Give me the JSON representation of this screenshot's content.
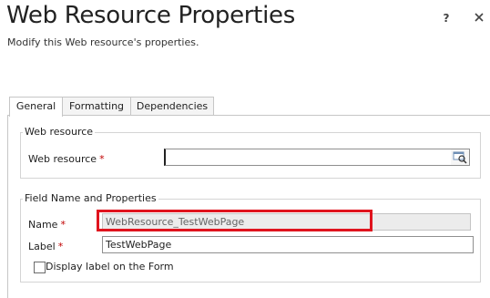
{
  "dialog": {
    "title": "Web Resource Properties",
    "subtitle": "Modify this Web resource's properties.",
    "help_label": "?",
    "close_icon": "close-icon"
  },
  "tabs": [
    {
      "label": "General",
      "active": true
    },
    {
      "label": "Formatting",
      "active": false
    },
    {
      "label": "Dependencies",
      "active": false
    }
  ],
  "web_resource_section": {
    "title": "Web resource",
    "field_label": "Web resource",
    "required_marker": "*",
    "value": "",
    "lookup_icon": "lookup-search-icon"
  },
  "field_section": {
    "title": "Field Name and Properties",
    "name_label": "Name",
    "name_value": "WebResource_TestWebPage",
    "label_label": "Label",
    "label_value": "TestWebPage",
    "required_marker": "*",
    "checkbox_label": "Display label on the Form",
    "checkbox_checked": false
  },
  "colors": {
    "highlight": "#e0141e",
    "required": "#c00000"
  }
}
